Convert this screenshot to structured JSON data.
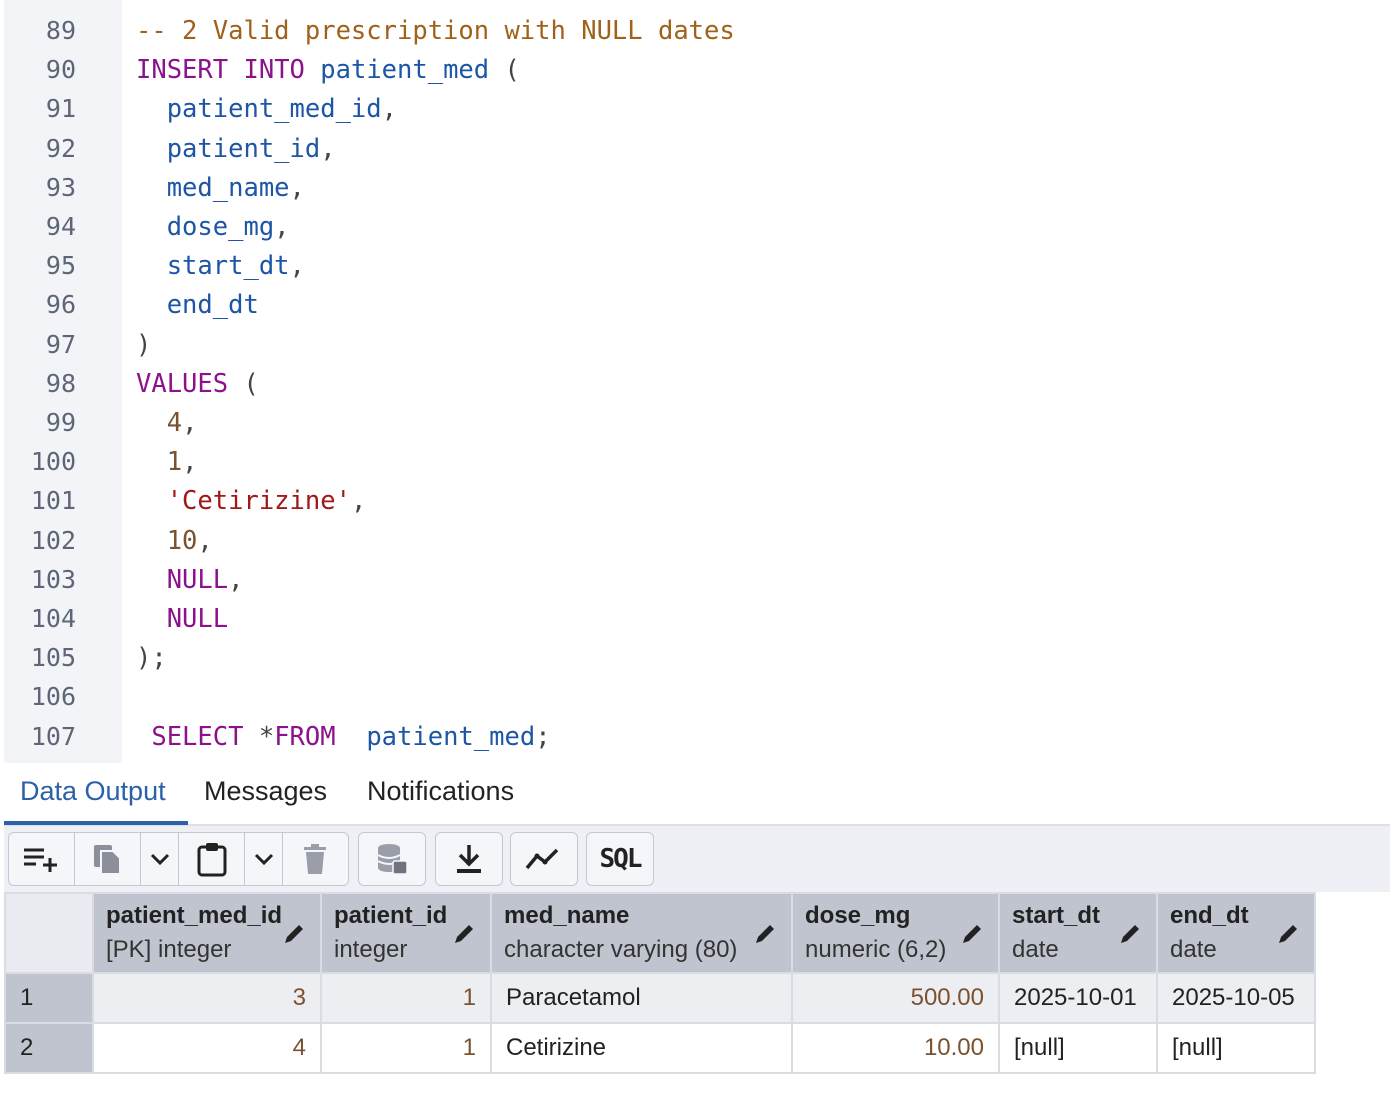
{
  "editor": {
    "line_numbers": [
      "89",
      "90",
      "91",
      "92",
      "93",
      "94",
      "95",
      "96",
      "97",
      "98",
      "99",
      "100",
      "101",
      "102",
      "103",
      "104",
      "105",
      "106",
      "107"
    ],
    "lines": [
      [
        {
          "t": "-- 2 Valid prescription with NULL dates",
          "c": "cm"
        }
      ],
      [
        {
          "t": "INSERT",
          "c": "kw"
        },
        {
          "t": " ",
          "c": "pn"
        },
        {
          "t": "INTO",
          "c": "kw"
        },
        {
          "t": " patient_med",
          "c": "id"
        },
        {
          "t": " (",
          "c": "pn"
        }
      ],
      [
        {
          "t": "  patient_med_id",
          "c": "id"
        },
        {
          "t": ",",
          "c": "pn"
        }
      ],
      [
        {
          "t": "  patient_id",
          "c": "id"
        },
        {
          "t": ",",
          "c": "pn"
        }
      ],
      [
        {
          "t": "  med_name",
          "c": "id"
        },
        {
          "t": ",",
          "c": "pn"
        }
      ],
      [
        {
          "t": "  dose_mg",
          "c": "id"
        },
        {
          "t": ",",
          "c": "pn"
        }
      ],
      [
        {
          "t": "  start_dt",
          "c": "id"
        },
        {
          "t": ",",
          "c": "pn"
        }
      ],
      [
        {
          "t": "  end_dt",
          "c": "id"
        }
      ],
      [
        {
          "t": ")",
          "c": "pn"
        }
      ],
      [
        {
          "t": "VALUES",
          "c": "kw"
        },
        {
          "t": " (",
          "c": "pn"
        }
      ],
      [
        {
          "t": "  4",
          "c": "num"
        },
        {
          "t": ",",
          "c": "pn"
        }
      ],
      [
        {
          "t": "  1",
          "c": "num"
        },
        {
          "t": ",",
          "c": "pn"
        }
      ],
      [
        {
          "t": "  'Cetirizine'",
          "c": "str"
        },
        {
          "t": ",",
          "c": "pn"
        }
      ],
      [
        {
          "t": "  10",
          "c": "num"
        },
        {
          "t": ",",
          "c": "pn"
        }
      ],
      [
        {
          "t": "  NULL",
          "c": "kw"
        },
        {
          "t": ",",
          "c": "pn"
        }
      ],
      [
        {
          "t": "  NULL",
          "c": "kw"
        }
      ],
      [
        {
          "t": ");",
          "c": "pn"
        }
      ],
      [],
      [
        {
          "t": " SELECT",
          "c": "kw"
        },
        {
          "t": " *",
          "c": "pn"
        },
        {
          "t": "FROM",
          "c": "kw"
        },
        {
          "t": "  patient_med",
          "c": "id"
        },
        {
          "t": ";",
          "c": "pn"
        }
      ]
    ]
  },
  "tabs": [
    "Data Output",
    "Messages",
    "Notifications"
  ],
  "toolbar": {
    "icons": [
      "add-row-icon",
      "copy-icon",
      "chevron-down-icon",
      "paste-icon",
      "chevron-down-icon",
      "delete-icon",
      "save-data-icon",
      "download-icon",
      "graph-icon",
      "sql-icon"
    ],
    "sql_label": "SQL"
  },
  "grid": {
    "columns": [
      {
        "name": "patient_med_id",
        "type": "[PK] integer"
      },
      {
        "name": "patient_id",
        "type": "integer"
      },
      {
        "name": "med_name",
        "type": "character varying (80)"
      },
      {
        "name": "dose_mg",
        "type": "numeric (6,2)"
      },
      {
        "name": "start_dt",
        "type": "date"
      },
      {
        "name": "end_dt",
        "type": "date"
      }
    ],
    "rows": [
      {
        "n": "1",
        "cells": [
          "3",
          "1",
          "Paracetamol",
          "500.00",
          "2025-10-01",
          "2025-10-05"
        ]
      },
      {
        "n": "2",
        "cells": [
          "4",
          "1",
          "Cetirizine",
          "10.00",
          "[null]",
          "[null]"
        ]
      }
    ]
  },
  "colors": {
    "accent": "#2a61a8",
    "keyword": "#8b128b",
    "identifier": "#1d56a6",
    "number": "#7a5230",
    "string": "#a01818",
    "comment": "#a0621a"
  }
}
